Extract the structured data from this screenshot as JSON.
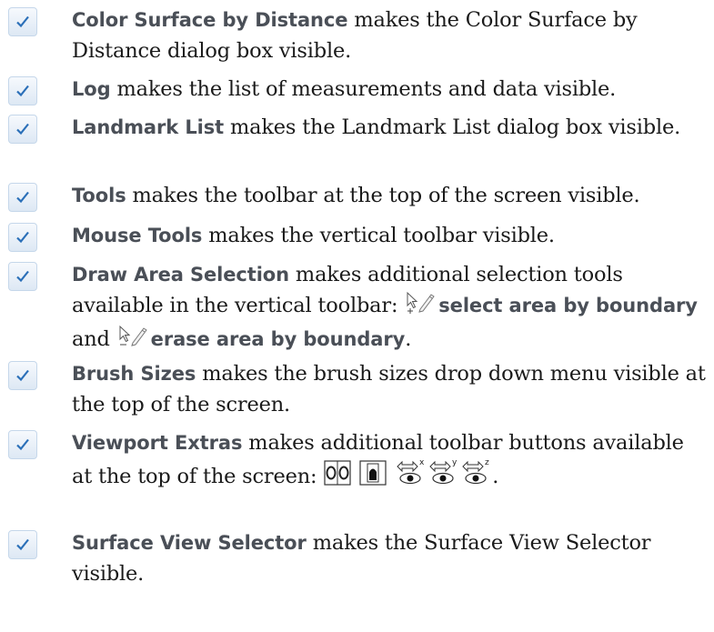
{
  "entries": [
    {
      "term": "Color Surface by Distance",
      "desc": " makes the Color Surface by Distance dialog box visible."
    },
    {
      "term": "Log",
      "desc": " makes the list of measurements and data visible."
    },
    {
      "term": "Landmark List",
      "desc": " makes the Landmark List dialog box visible."
    },
    {
      "term": "Tools",
      "desc": " makes the toolbar at the top of the screen visible."
    },
    {
      "term": "Mouse Tools",
      "desc": " makes the vertical toolbar visible."
    },
    {
      "term": "Draw Area Selection",
      "desc": " makes additional selection tools available in the vertical toolbar: ",
      "tool1": "select area by boundary",
      "and": " and ",
      "tool2": "erase area by boundary",
      "end": "."
    },
    {
      "term": "Brush Sizes",
      "desc": " makes the brush sizes drop down menu visible at the top of the screen."
    },
    {
      "term": "Viewport Extras",
      "desc": " makes additional toolbar buttons available at the top of the screen: ",
      "end": ".",
      "axes": [
        "x",
        "y",
        "z"
      ]
    },
    {
      "term": "Surface View Selector",
      "desc": " makes the Surface View Selector visible."
    }
  ],
  "icons": {
    "check": "checkmark-icon",
    "select_boundary": "select-area-by-boundary-icon",
    "erase_boundary": "erase-area-by-boundary-icon",
    "viewport_split": "split-viewport-icon",
    "viewport_single": "single-viewport-icon",
    "rotate_axis": "rotate-eye-icon"
  },
  "colors": {
    "check": "#2a6fb8",
    "term": "#4a4f57",
    "box_border": "#c5d7ea"
  }
}
